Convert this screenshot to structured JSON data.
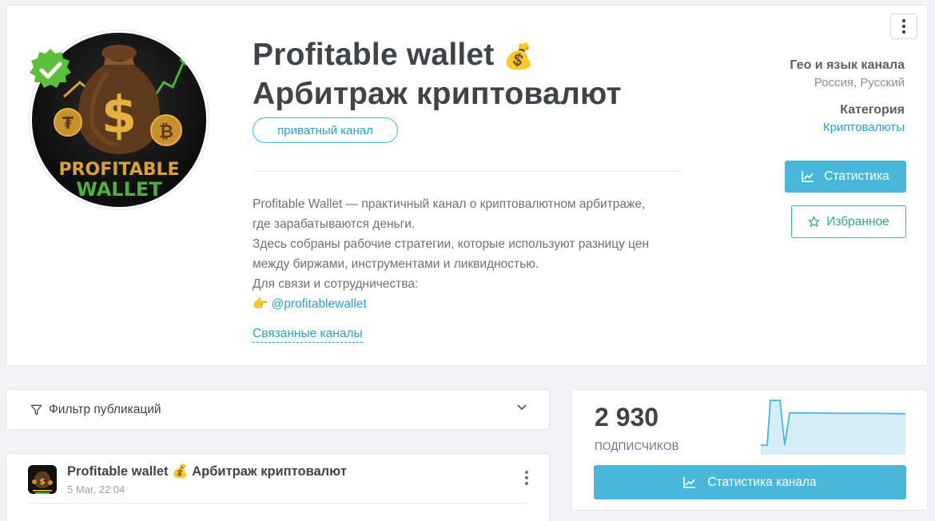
{
  "channel": {
    "title_line1": "Profitable wallet",
    "title_emoji": "💰",
    "title_line2": "Арбитраж криптовалют",
    "badge": "приватный канал",
    "logo_text_line1": "PROFITABLE",
    "logo_text_line2": "WALLET",
    "description_lines": [
      "Profitable Wallet — практичный канал о криптовалютном арбитраже,",
      "где зарабатываются деньги.",
      "Здесь собраны рабочие стратегии, которые используют разницу цен",
      "между биржами, инструментами и ликвидностью.",
      "Для связи и сотрудничества:"
    ],
    "contact_emoji": "👉",
    "contact_link": "@profitablewallet",
    "related_link": "Связанные каналы"
  },
  "meta": {
    "geo_label": "Гео и язык канала",
    "geo_value": "Россия, Русский",
    "category_label": "Категория",
    "category_value": "Криптовалюты"
  },
  "actions": {
    "stats_button": "Статистика",
    "favorite_button": "Избранное",
    "channel_stats_button": "Статистика канала"
  },
  "filter": {
    "label": "Фильтр публикаций"
  },
  "post": {
    "title": "Profitable wallet 💰 Арбитраж криптовалют",
    "time": "5 Mar, 22:04"
  },
  "subscribers": {
    "count": "2 930",
    "label": "ПОДПИСЧИКОВ",
    "trend": [
      0,
      0,
      1,
      1,
      0,
      0.72,
      0.72,
      0.71,
      0.71,
      0.7
    ]
  },
  "colors": {
    "accent": "#47b8d9",
    "favorite": "#35b59b",
    "verified": "#5cbf3a",
    "gold": "#d9a334",
    "green_text": "#4caf3e"
  }
}
